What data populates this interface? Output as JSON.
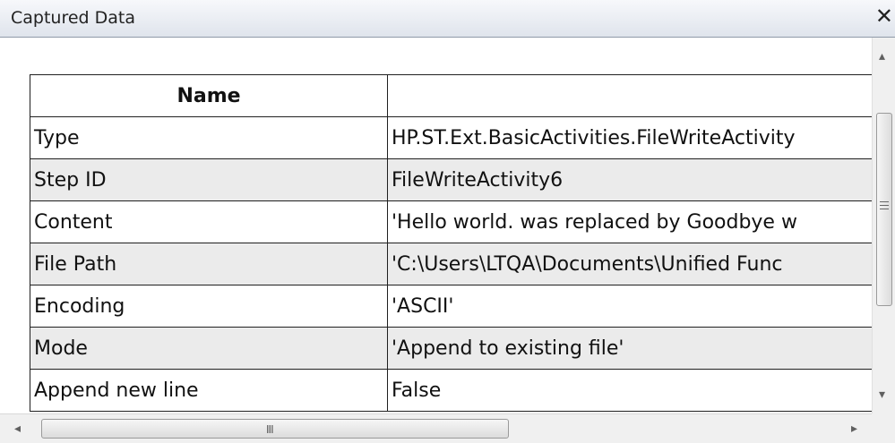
{
  "window": {
    "title": "Captured Data",
    "close_glyph": "✕"
  },
  "table": {
    "header": {
      "name": "Name",
      "value": ""
    },
    "rows": [
      {
        "name": "Type",
        "value": "HP.ST.Ext.BasicActivities.FileWriteActivity"
      },
      {
        "name": "Step ID",
        "value": "FileWriteActivity6"
      },
      {
        "name": "Content",
        "value": "'Hello world. was replaced by Goodbye w"
      },
      {
        "name": "File Path",
        "value": "'C:\\Users\\LTQA\\Documents\\Unified Func"
      },
      {
        "name": "Encoding",
        "value": "'ASCII'"
      },
      {
        "name": "Mode",
        "value": "'Append to existing file'"
      },
      {
        "name": "Append new line",
        "value": "False"
      }
    ]
  },
  "scrollbars": {
    "up_arrow": "▴",
    "down_arrow": "▾",
    "left_arrow": "◂",
    "right_arrow": "▸",
    "h_grip": "III"
  }
}
